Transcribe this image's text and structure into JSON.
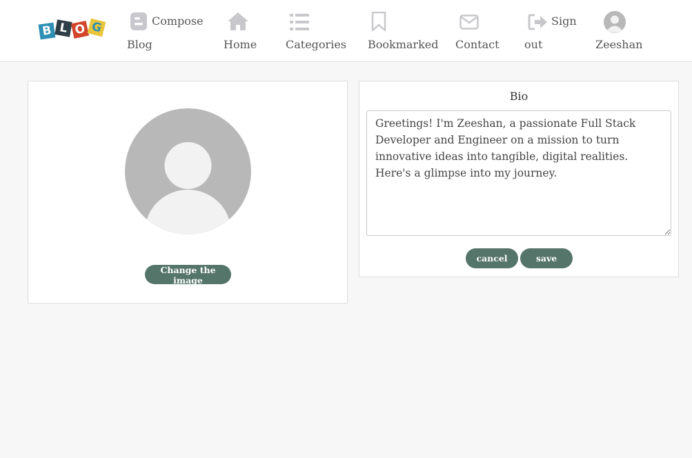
{
  "header": {
    "logo_letters": [
      "B",
      "L",
      "O",
      "G"
    ],
    "logo_colors": [
      "#2f8fb5",
      "#2f3e46",
      "#d2452b",
      "#e8c53a"
    ],
    "nav": {
      "compose": {
        "line1": "Compose",
        "line2": "Blog",
        "icon": "blogger-icon"
      },
      "home": {
        "label": "Home",
        "icon": "home-icon"
      },
      "categories": {
        "label": "Categories",
        "icon": "list-icon"
      },
      "bookmarked": {
        "label": "Bookmarked",
        "icon": "bookmark-icon"
      },
      "contact": {
        "label": "Contact",
        "icon": "envelope-icon"
      },
      "signout": {
        "line1": "Sign",
        "line2": "out",
        "icon": "sign-out-icon"
      },
      "user": {
        "label": "Zeeshan",
        "icon": "user-avatar-icon"
      }
    },
    "icon_color": "#c8c8cc"
  },
  "profile_image_card": {
    "avatar_icon": "default-user-avatar-icon",
    "change_button_label": "Change the image"
  },
  "bio_card": {
    "title": "Bio",
    "text": "Greetings! I'm Zeeshan, a passionate Full Stack Developer and Engineer on a mission to turn innovative ideas into tangible, digital realities. Here's a glimpse into my journey.",
    "cancel_label": "cancel",
    "save_label": "save"
  },
  "colors": {
    "accent": "#55746a",
    "page_background": "#f7f7f7",
    "avatar_gray": "#b8b8b8"
  }
}
